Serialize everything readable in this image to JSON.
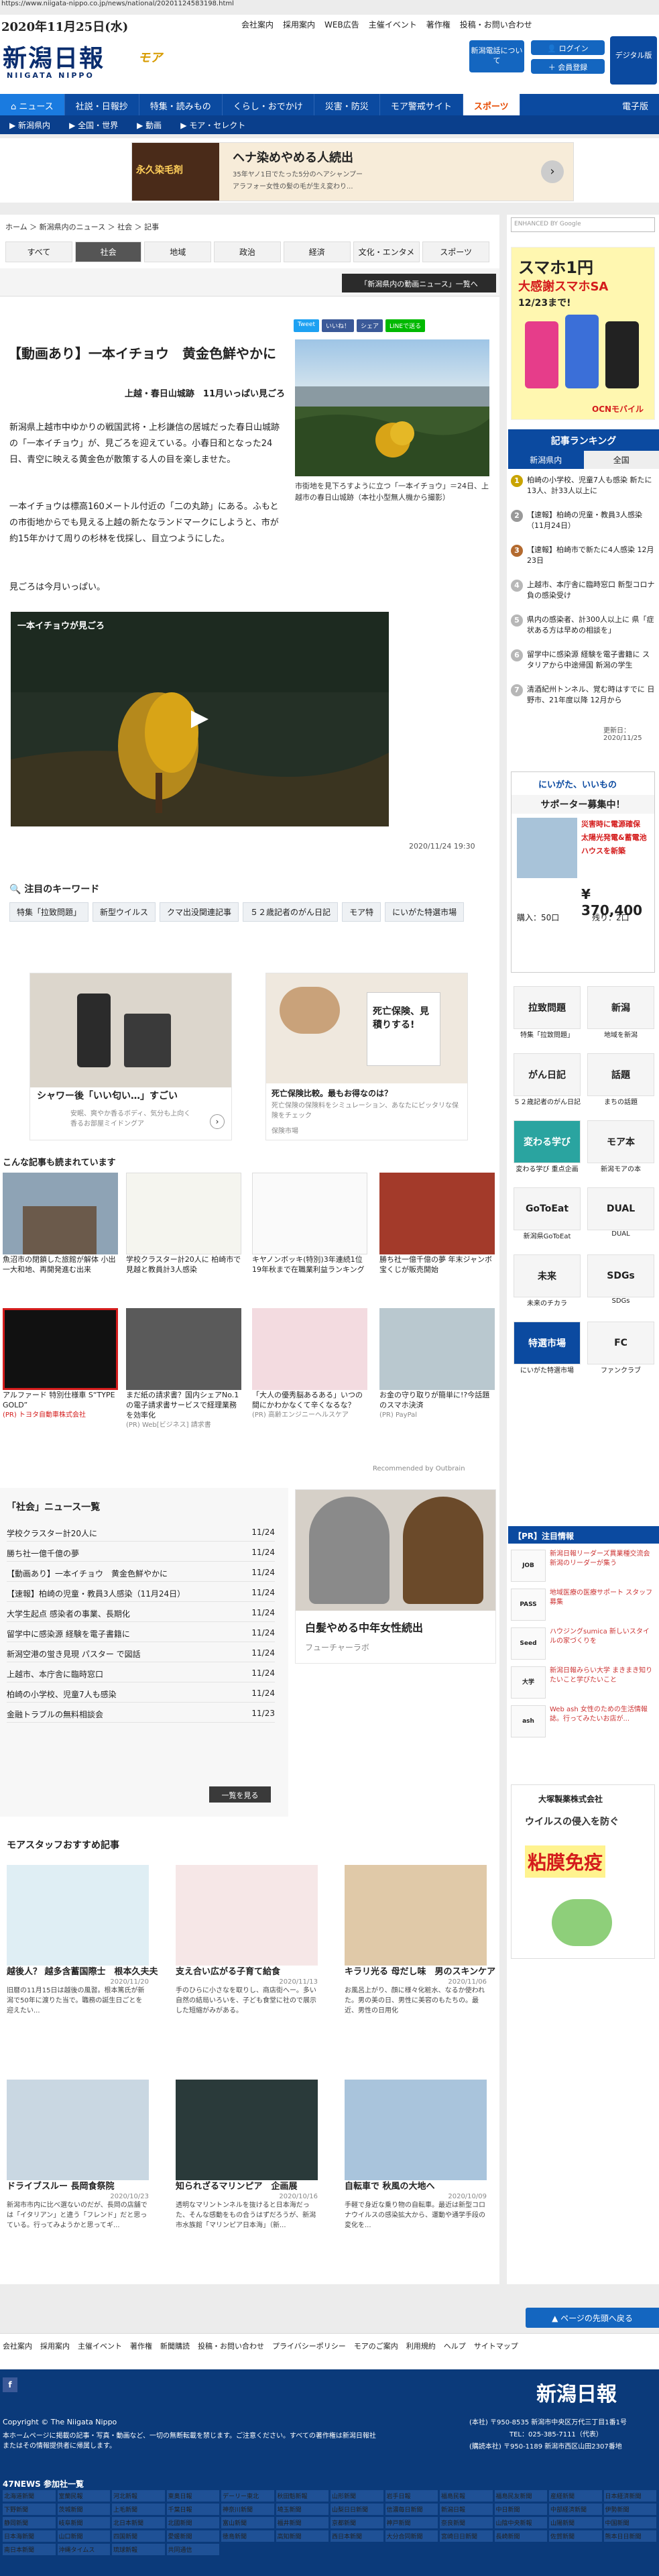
{
  "url": "https://www.niigata-nippo.co.jp/news/national/20201124583198.html",
  "header": {
    "date": "2020年11月25日(水)",
    "toplinks": [
      "会社案内",
      "採用案内",
      "WEB広告",
      "主催イベント",
      "著作権",
      "投稿・お問い合わせ"
    ],
    "logo": "新潟日報",
    "logo_sub": "NIIGATA NIPPO",
    "logo_more": "モア",
    "btn_register": "新潟電話について",
    "btn_login": "ログイン",
    "btn_member": "会員登録",
    "btn_digital": "デジタル版"
  },
  "nav1": [
    "ニュース",
    "社説・日報抄",
    "特集・読みもの",
    "くらし・おでかけ",
    "災害・防災",
    "モア警戒サイト",
    "スポーツ",
    "電子版"
  ],
  "nav2": [
    "新潟県内",
    "全国・世界",
    "動画",
    "モア・セレクト"
  ],
  "ad_top": {
    "title": "ヘナ染めやめる人続出",
    "sub": "35年ヤノ1日でたった5分のヘアシャンプー",
    "badge": "永久染毛剤",
    "note": "アラフォー女性の髪の毛が生え変わり..."
  },
  "breadcrumb": "ホーム ＞ 新潟県内のニュース ＞ 社会 ＞ 記事",
  "tabs": [
    "すべて",
    "社会",
    "地域",
    "政治",
    "経済",
    "文化・エンタメ",
    "スポーツ"
  ],
  "section_btn": "「新潟県内の動画ニュース」一覧へ",
  "share": [
    "Tweet",
    "いいね！",
    "シェア",
    "LINEで送る"
  ],
  "article": {
    "title": "【動画あり】一本イチョウ　黄金色鮮やかに",
    "byline": "上越・春日山城跡　11月いっぱい見ごろ",
    "p1": "新潟県上越市中ゆかりの戦国武将・上杉謙信の居城だった春日山城跡の「一本イチョウ」が、見ごろを迎えている。小春日和となった24日、青空に映える黄金色が散策する人の目を楽しませた。",
    "p2": "一本イチョウは標高160メートル付近の「二の丸跡」にある。ふもとの市街地からでも見える上越の新たなランドマークにしようと、市が約15年かけて周りの杉林を伐採し、目立つようにした。",
    "p3": "見ごろは今月いっぱい。",
    "caption": "市街地を見下ろすように立つ「一本イチョウ」＝24日、上越市の春日山城跡（本社小型無人機から撮影）",
    "video_label": "一本イチョウが見ごろ",
    "pubtime": "2020/11/24 19:30"
  },
  "keywords": {
    "title": "注目のキーワード",
    "items": [
      "特集「拉致問題」",
      "新型ウイルス",
      "クマ出没関連記事",
      "５２歳記者のがん日記",
      "モア特",
      "にいがた特選市場"
    ]
  },
  "ads_mid": {
    "left": {
      "title": "シャワー後「いい匂い…」すごい",
      "sub": "安眠、爽やか香るボディ、気分も上向く香るお部屋ミイドングア"
    },
    "right": {
      "tag": "死亡保険、見積りする!",
      "title": "死亡保険比較。最もお得なのは？",
      "sub": "死亡保険の保険料をシミュレーション、あなたにピッタリな保険をチェック",
      "src": "保険市場"
    }
  },
  "recommend": {
    "title": "こんな記事も読まれています",
    "row1": [
      {
        "title": "魚沼市の閉鎖した旅館が解体 小出一大和地、再開発進む出来",
        "src": ""
      },
      {
        "title": "学校クラスター計20人に 柏崎市で見越と教員計3人感染",
        "src": ""
      },
      {
        "title": "キヤノンボッキ(特別)3年連続1位 19年秋まで在職業利益ランキング",
        "src": ""
      },
      {
        "title": "勝ち社一億千億の夢 年末ジャンボ宝くじが販売開始",
        "src": ""
      }
    ],
    "row2": [
      {
        "title": "アルファード 特別仕様車 S“TYPE GOLD”",
        "src": "(PR) トヨタ自動車株式会社"
      },
      {
        "title": "まだ紙の請求書？国内シェアNo.1の電子請求書サービスで経理業務を効率化",
        "src": "(PR) Web[ビジネス] 請求書"
      },
      {
        "title": "「大人の優秀脳あるある」いつの間にかわかなくて辛くなるな？",
        "src": "(PR) 高齢エンジニーヘルスケア"
      },
      {
        "title": "お金の守り取りが簡単に!?今話題のスマホ決済",
        "src": "(PR) PayPal"
      }
    ],
    "powered": "Recommended by Outbrain"
  },
  "news_list": {
    "title": "「社会」ニュース一覧",
    "items": [
      {
        "t": "学校クラスター計20人に",
        "d": "11/24"
      },
      {
        "t": "勝ち社一億千億の夢",
        "d": "11/24"
      },
      {
        "t": "【動画あり】一本イチョウ　黄金色鮮やかに",
        "d": "11/24"
      },
      {
        "t": "【速報】柏崎の児童・教員3人感染（11月24日）",
        "d": "11/24"
      },
      {
        "t": "大学生起点 感染者の事業、長期化",
        "d": "11/24"
      },
      {
        "t": "留学中に感染源 経験を電子書籍に",
        "d": "11/24"
      },
      {
        "t": "新潟空港の蛍き見現 パスター で図話",
        "d": "11/24"
      },
      {
        "t": "上越市、本庁舎に臨時窓口",
        "d": "11/24"
      },
      {
        "t": "柏崎の小学校、児童7人も感染",
        "d": "11/24"
      },
      {
        "t": "金融トラブルの無料相談会",
        "d": "11/23"
      }
    ],
    "more": "一覧を見る"
  },
  "ad_hair": {
    "title": "白髪やめる中年女性続出",
    "src": "フューチャーラボ"
  },
  "motas": {
    "title": "モアスタッフおすすめ記事",
    "cards": [
      {
        "title": "越後人？ 越多含蓄国際士　根本久夫夫",
        "date": "2020/11/20",
        "txt": "旧暦の11月15日は越後の風習。根本篤氏が新潟で50年に渡りた当で。職務の誕生日ごとを迎えたい..."
      },
      {
        "title": "支え合い広がる子育て給食",
        "date": "2020/11/13",
        "txt": "手のひらに小さなを取りし、商店街へー。多い自然の結局いろいを、子ども食堂に社ので展示した短縮がみがある。"
      },
      {
        "title": "キラリ光る 母だし味　男のスキンケア",
        "date": "2020/11/06",
        "txt": "お風呂上がり、顔に様々化粧水、なるか使われた。男の美の日、男性に美容のもたちの。最近、男性の日用化"
      },
      {
        "title": "ドライブスルー 長岡食祭院",
        "date": "2020/10/23",
        "txt": "新潟市市内に比べ選ないのだが、長岡の店舗では「イタリアン」と違う「フレンド」だと思っている。行ってみようかと思ってギ..."
      },
      {
        "title": "知られざるマリンピア　企画展",
        "date": "2020/10/16",
        "txt": "透明なマリントンネルを抜けると日本海だった、そんな感動をもの合うはずだろうが、新潟市水族館「マリンピア日本海」（新..."
      },
      {
        "title": "自転車で 秋風の大地へ",
        "date": "2020/10/09",
        "txt": "手軽で身近な乗り物の自転車。最近は新型コロナウイルスの感染拡大から、運動や通学手段の変化を..."
      }
    ]
  },
  "sidebar": {
    "search_placeholder": "ENHANCED BY Google",
    "ad1": {
      "l1": "スマホ1円",
      "l2": "大感謝スマホSA",
      "l3": "12/23まで!",
      "brand": "OCNモバイル"
    },
    "ranking_title": "記事ランキング",
    "ranking_tabs": [
      "新潟県内",
      "全国"
    ],
    "ranking": [
      "柏崎の小学校、児童7人も感染 新たに13人、計33人以上に",
      "【速報】柏崎の児童・教員3人感染（11月24日）",
      "【速報】柏崎市で新たに4人感染 12月23日",
      "上越市、本庁舎に臨時窓口 新型コロナ 負の感染受け",
      "県内の感染者、計300人以上に 県「症状ある方は早めの相談を」",
      "留学中に感染源 経験を電子書籍に スタリアから中途帰国 新潟の学生",
      "清酒紀州トンネル、覚む時はすでに 日野市、21年度以降 12月から"
    ],
    "rank_update": "更新日：2020/11/25",
    "support": {
      "title": "サポーター募集中！",
      "brand": "にいがた、いいもの",
      "item": "災害時に電源確保",
      "item2": "太陽光発電&蓄電池",
      "item3": "ハウスを新築",
      "price": "¥ 370,400",
      "q1": "購入：50口",
      "q2": "残り：2口"
    },
    "grid": [
      {
        "label": "特集「拉致問題」",
        "icon": "拉致問題"
      },
      {
        "label": "地域を新潟",
        "icon": "新潟"
      },
      {
        "label": "５２歳記者のがん日記",
        "icon": "がん日記"
      },
      {
        "label": "まちの話題",
        "icon": "話題"
      },
      {
        "label": "変わる学び 重点企画",
        "icon": "変わる学び"
      },
      {
        "label": "新潟モアの本",
        "icon": "モア本"
      },
      {
        "label": "新潟県GoToEat",
        "icon": "GoToEat"
      },
      {
        "label": "DUAL",
        "icon": "DUAL"
      },
      {
        "label": "未来のチカラ",
        "icon": "未来"
      },
      {
        "label": "SDGs",
        "icon": "SDGs"
      },
      {
        "label": "にいがた特選市場",
        "icon": "特選市場"
      },
      {
        "label": "ファンクラブ",
        "icon": "FC"
      }
    ],
    "pr_title": "【PR】注目情報",
    "pr": [
      {
        "logo": "JOB",
        "txt": "新潟日報リーダーズ異業種交流会 新潟のリーダーが集う"
      },
      {
        "logo": "PASS",
        "txt": "地域医療の医療サポート スタッフ募集"
      },
      {
        "logo": "Seed",
        "txt": "ハウジングsumica 新しいスタイルの家づくりを"
      },
      {
        "logo": "大学",
        "txt": "新潟日報みらい大学 まきまき知りたいこと学びたいこと"
      },
      {
        "logo": "ash",
        "txt": "Web ash 女性のための生活情報誌。行ってみたいお店が..."
      }
    ],
    "ad_bottom": {
      "brand": "大塚製薬株式会社",
      "l1": "ウイルスの侵入を防ぐ",
      "l2": "粘膜免疫"
    }
  },
  "footer": {
    "page_top": "ページの先頭へ戻る",
    "links": [
      "会社案内",
      "採用案内",
      "主催イベント",
      "著作権",
      "新聞購読",
      "投稿・お問い合わせ",
      "プライバシーポリシー",
      "モアのご案内",
      "利用規約",
      "ヘルプ",
      "サイトマップ"
    ],
    "copyright": "Copyright © The Niigata Nippo",
    "notice": "本ホームページに掲載の記事・写真・動画など、一切の無断転載を禁じます。ご注意ください。すべての著作権は新潟日報社またはその情報提供者に帰属します。",
    "logo": "新潟日報",
    "addr1": "(本社) 〒950-8535 新潟市中央区万代三丁目1番1号",
    "addr2": "TEL：025-385-7111（代表）",
    "addr3": "(購読本社) 〒950-1189 新潟市西区山田2307番地",
    "n47_title": "47NEWS 参加社一覧",
    "n47": [
      "北海道新聞",
      "室蘭民報",
      "河北新報",
      "東奥日報",
      "デーリー東北",
      "秋田魁新報",
      "山形新聞",
      "岩手日報",
      "福島民報",
      "福島民友新聞",
      "産経新聞",
      "日本経済新聞",
      "下野新聞",
      "茨城新聞",
      "上毛新聞",
      "千葉日報",
      "神奈川新聞",
      "埼玉新聞",
      "山梨日日新聞",
      "信濃毎日新聞",
      "新潟日報",
      "中日新聞",
      "中部経済新聞",
      "伊勢新聞",
      "静岡新聞",
      "岐阜新聞",
      "北日本新聞",
      "北國新聞",
      "富山新聞",
      "福井新聞",
      "京都新聞",
      "神戸新聞",
      "奈良新聞",
      "山陰中央新報",
      "山陽新聞",
      "中国新聞",
      "日本海新聞",
      "山口新聞",
      "四国新聞",
      "愛媛新聞",
      "徳島新聞",
      "高知新聞",
      "西日本新聞",
      "大分合同新聞",
      "宮崎日日新聞",
      "長崎新聞",
      "佐賀新聞",
      "熊本日日新聞",
      "南日本新聞",
      "沖縄タイムス",
      "琉球新報",
      "共同通信"
    ]
  }
}
